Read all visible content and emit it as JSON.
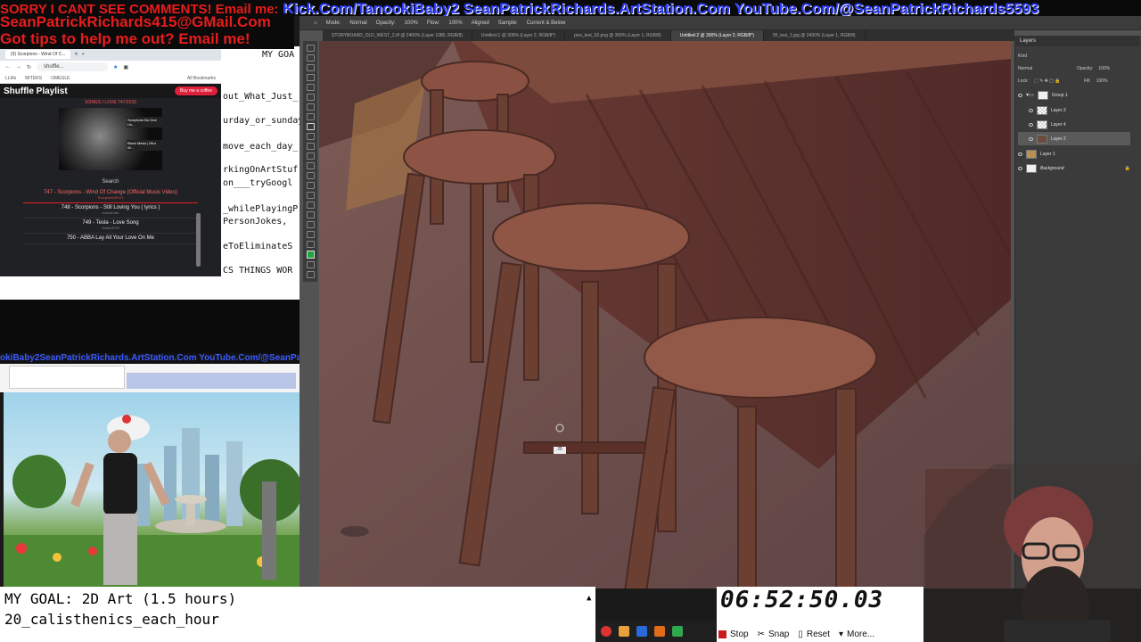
{
  "overlay": {
    "line1_red": "SORRY I CANT SEE COMMENTS! Email me:",
    "line1_blue_1": "Kick.Com/TanookiBaby2",
    "line1_blue_2": "SeanPatrickRichards.ArtStation.Com",
    "line1_blue_3": "YouTube.Com/@SeanPatrickRichards5593",
    "line2": "SeanPatrickRichards415@GMail.Com",
    "line3": "Got tips to help me out? Email me!"
  },
  "photoshop": {
    "options": [
      "Mode:",
      "Normal",
      "Opacity:",
      "100%",
      "Flow:",
      "100%",
      "Aligned",
      "Sample:",
      "Current & Below"
    ],
    "tabs": [
      "STORYBOARD_OLD_WEST_2.tif @ 2400% (Layer 1080, RGB/8)",
      "Untitled-1 @ 300% (Layer 2, RGB/8*)",
      "pixx_test_02.png @ 300% (Layer 1, RGB/8)",
      "Untitled-2 @ 300% (Layer 2, RGB/8*)",
      "00_test_1.jpg @ 2400% (Layer 1, RGB/8)"
    ],
    "active_tab": 3,
    "brush_size_label": "25",
    "layers_panel": {
      "title": "Layers",
      "kind": "Kind",
      "blend_mode": "Normal",
      "opacity_label": "Opacity:",
      "opacity": "100%",
      "lock_label": "Lock:",
      "fill_label": "Fill:",
      "fill": "100%",
      "layers": [
        {
          "name": "Group 1",
          "thumb": "folder"
        },
        {
          "name": "Layer 3",
          "thumb": "transparent"
        },
        {
          "name": "Layer 4",
          "thumb": "transparent"
        },
        {
          "name": "Layer 2",
          "thumb": "img",
          "active": true
        },
        {
          "name": "Layer 1",
          "thumb": "img2"
        },
        {
          "name": "Background",
          "thumb": "solid"
        }
      ]
    }
  },
  "browser": {
    "tab_title": "(9) Scorpions - Wind Of C...",
    "address": "shuffle...",
    "bookmarks": [
      "LLMs",
      "MITERS",
      "OMEGLE",
      "All Bookmarks"
    ]
  },
  "playlist": {
    "title": "Shuffle Playlist",
    "coffee_button": "Buy me a coffee",
    "subtitle": "SONGS I LOVE  747/2233",
    "art_label_1": "Scorpions No One Lik...",
    "art_label_2": "Black Metal | Vitor W...",
    "search_label": "Search",
    "items": [
      {
        "title": "747 - Scorpions - Wind Of Change (Official Music Video)",
        "channel": "ScorpionsVEVO",
        "current": true
      },
      {
        "title": "748 - Scorpions - Still Loving You ( lyrics )",
        "channel": "chocoholic"
      },
      {
        "title": "749 - Tesla - Love Song",
        "channel": "TeslaVEVO"
      },
      {
        "title": "750 - ABBA Lay All Your Love On Me",
        "channel": ""
      }
    ]
  },
  "editor": {
    "lines": [
      "MY GOA",
      "out_What_Just_",
      "urday_or_sunday",
      "move_each_day_",
      "rkingOnArtStuf",
      "on___tryGoogl",
      "_whilePlayingP",
      "PersonJokes,",
      "eToEliminateS",
      "CS THINGS WOR"
    ]
  },
  "nested": {
    "banner": "okiBaby2SeanPatrickRichards.ArtStation.Com YouTube.Com/@SeanPatric"
  },
  "goal": {
    "line1": "MY GOAL: 2D Art (1.5 hours)",
    "line2": "20_calisthenics_each_hour"
  },
  "stopwatch": {
    "time": "06:52:50.03",
    "stop": "Stop",
    "snap": "Snap",
    "reset": "Reset",
    "more": "More..."
  },
  "colors": {
    "overlay_red": "#e81c1c",
    "overlay_blue": "#2a3cff",
    "foreground_swatch": "#1ca83a"
  }
}
